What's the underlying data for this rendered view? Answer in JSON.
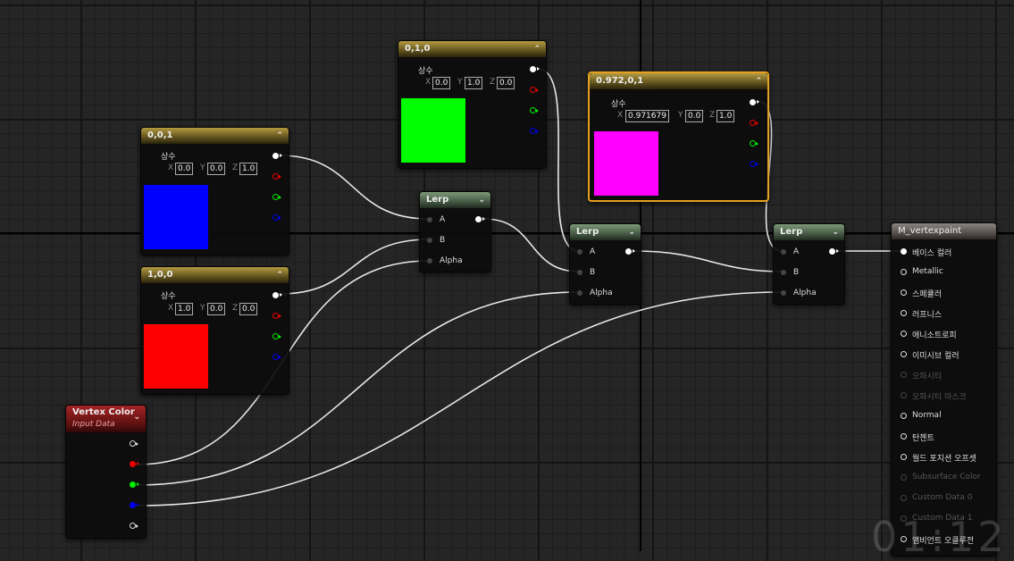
{
  "nodes": {
    "const_001": {
      "title": "0,0,1",
      "label": "상수",
      "x_label": "X",
      "y_label": "Y",
      "z_label": "Z",
      "x": "0.0",
      "y": "0.0",
      "z": "1.0",
      "color": "#0000ff"
    },
    "const_100": {
      "title": "1,0,0",
      "label": "상수",
      "x_label": "X",
      "y_label": "Y",
      "z_label": "Z",
      "x": "1.0",
      "y": "0.0",
      "z": "0.0",
      "color": "#ff0000"
    },
    "const_010": {
      "title": "0,1,0",
      "label": "상수",
      "x_label": "X",
      "y_label": "Y",
      "z_label": "Z",
      "x": "0.0",
      "y": "1.0",
      "z": "0.0",
      "color": "#00ff00"
    },
    "const_0972": {
      "title": "0.972,0,1",
      "label": "상수",
      "x_label": "X",
      "y_label": "Y",
      "z_label": "Z",
      "x": "0.971679",
      "y": "0.0",
      "z": "1.0",
      "color": "#ff00ff"
    },
    "lerp1": {
      "title": "Lerp",
      "a": "A",
      "b": "B",
      "alpha": "Alpha"
    },
    "lerp2": {
      "title": "Lerp",
      "a": "A",
      "b": "B",
      "alpha": "Alpha"
    },
    "lerp3": {
      "title": "Lerp",
      "a": "A",
      "b": "B",
      "alpha": "Alpha"
    },
    "vertex_color": {
      "title": "Vertex Color",
      "subtitle": "Input Data"
    },
    "material": {
      "title": "M_vertexpaint",
      "inputs": [
        {
          "label": "베이스 컬러",
          "state": "connected"
        },
        {
          "label": "Metallic",
          "state": "active"
        },
        {
          "label": "스페큘러",
          "state": "active"
        },
        {
          "label": "러프니스",
          "state": "active"
        },
        {
          "label": "애니소트로피",
          "state": "active"
        },
        {
          "label": "이미시브 컬러",
          "state": "active"
        },
        {
          "label": "오파시티",
          "state": "disabled"
        },
        {
          "label": "오파시티 마스크",
          "state": "disabled"
        },
        {
          "label": "Normal",
          "state": "active"
        },
        {
          "label": "탄젠트",
          "state": "active"
        },
        {
          "label": "월드 포지션 오프셋",
          "state": "active"
        },
        {
          "label": "Subsurface Color",
          "state": "disabled"
        },
        {
          "label": "Custom Data 0",
          "state": "disabled"
        },
        {
          "label": "Custom Data 1",
          "state": "disabled"
        },
        {
          "label": "앰비언트 오클루전",
          "state": "active"
        }
      ]
    }
  },
  "watermark": "01:12"
}
